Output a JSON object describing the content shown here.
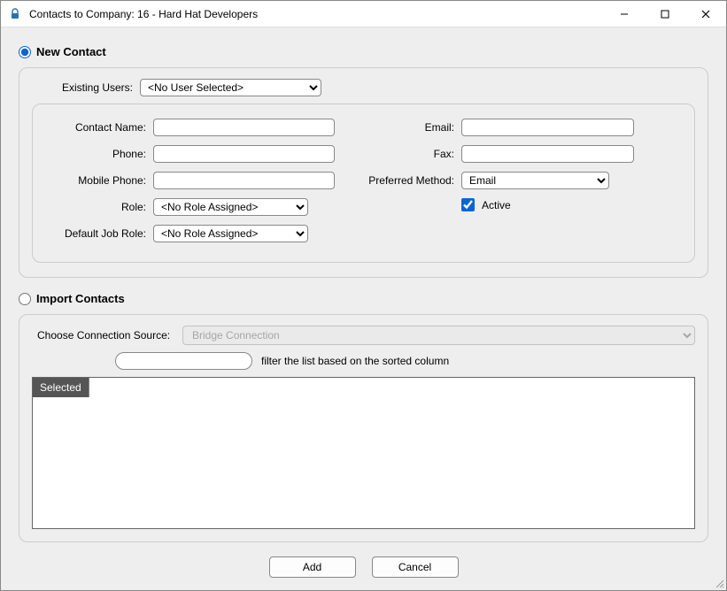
{
  "window": {
    "title": "Contacts to Company: 16 - Hard Hat Developers"
  },
  "options": {
    "newContactLabel": "New Contact",
    "importContactsLabel": "Import Contacts",
    "selected": "new"
  },
  "newContact": {
    "existingUsersLabel": "Existing Users:",
    "existingUsersValue": "<No User Selected>",
    "contactNameLabel": "Contact Name:",
    "contactName": "",
    "phoneLabel": "Phone:",
    "phone": "",
    "mobilePhoneLabel": "Mobile Phone:",
    "mobilePhone": "",
    "roleLabel": "Role:",
    "roleValue": "<No Role Assigned>",
    "defaultJobRoleLabel": "Default Job Role:",
    "defaultJobRoleValue": "<No Role Assigned>",
    "emailLabel": "Email:",
    "email": "",
    "faxLabel": "Fax:",
    "fax": "",
    "preferredMethodLabel": "Preferred Method:",
    "preferredMethodValue": "Email",
    "activeLabel": "Active",
    "activeChecked": true
  },
  "import": {
    "connectionLabel": "Choose Connection Source:",
    "connectionValue": "Bridge Connection",
    "filterHint": "filter the list based on the sorted column",
    "filterValue": "",
    "gridColumns": [
      "Selected"
    ]
  },
  "buttons": {
    "add": "Add",
    "cancel": "Cancel"
  }
}
